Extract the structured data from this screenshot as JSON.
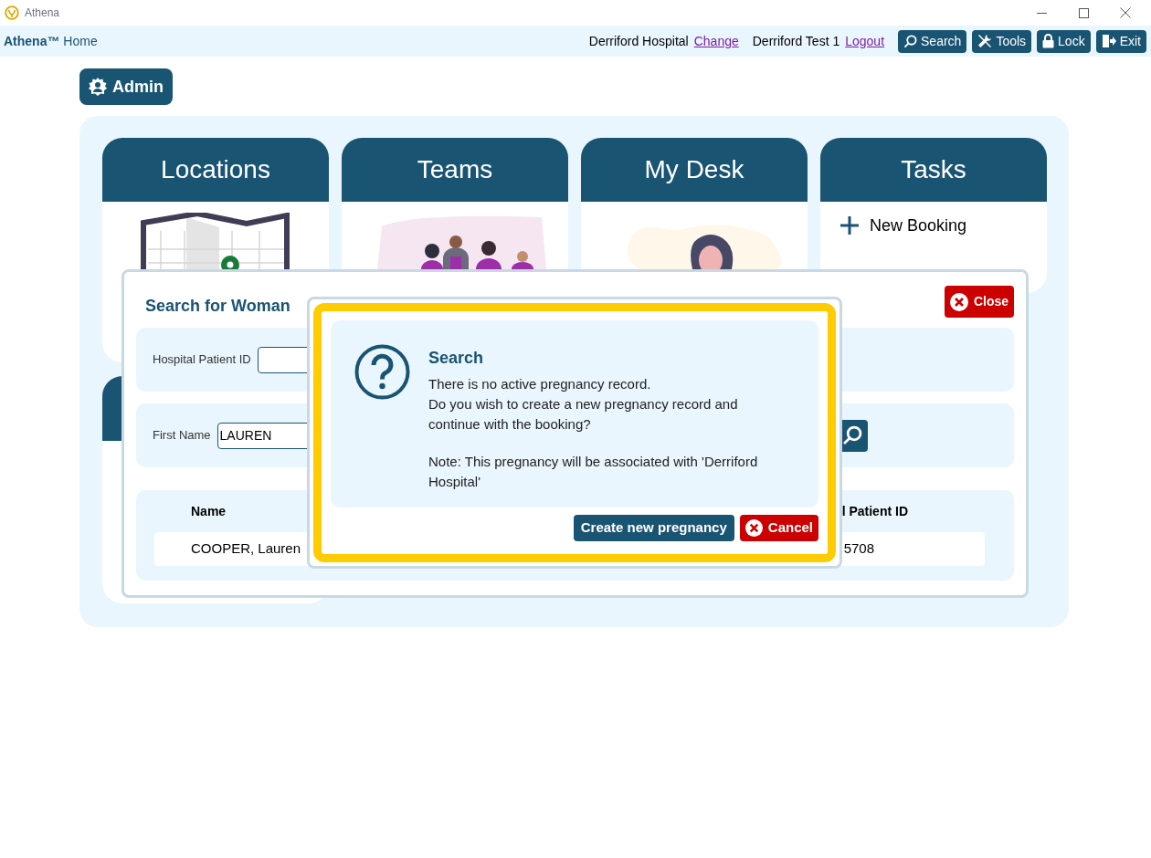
{
  "window": {
    "title": "Athena"
  },
  "header": {
    "brand": "**Athena™** Home",
    "hospital": "Derriford Hospital",
    "change_link": "Change",
    "user": "Derriford Test 1",
    "logout_link": "Logout",
    "buttons": [
      {
        "label": "Search",
        "kind": "search"
      },
      {
        "label": "Tools",
        "kind": "tools"
      },
      {
        "label": "Lock",
        "kind": "lock"
      },
      {
        "label": "Exit",
        "kind": "exit"
      }
    ]
  },
  "admin_button": "Admin",
  "tiles": [
    {
      "title": "Locations",
      "kind": "map"
    },
    {
      "title": "Teams",
      "kind": "team"
    },
    {
      "title": "My Desk",
      "kind": "person"
    },
    {
      "title": "Tasks",
      "kind": "tasks",
      "items": [
        "New Booking"
      ]
    }
  ],
  "search_dialog": {
    "title": "Search for Woman",
    "close": "Close",
    "fields": [
      {
        "label": "Hospital Patient ID"
      },
      {
        "label": "First Name",
        "value": "LAUREN"
      }
    ],
    "columns": [
      "Name",
      "l Patient ID"
    ],
    "rows": [
      [
        "COOPER, Lauren",
        "5708"
      ]
    ]
  },
  "confirm_dialog": {
    "title": "Search",
    "message": "There is no active pregnancy record.\nDo you wish to create a new pregnancy record and\ncontinue with the booking?",
    "note": "Note: This pregnancy will be associated with 'Derriford Hospital'",
    "buttons": [
      {
        "label": "Create new pregnancy",
        "kind": "primary"
      },
      {
        "label": "Cancel",
        "kind": "cancel"
      }
    ]
  }
}
